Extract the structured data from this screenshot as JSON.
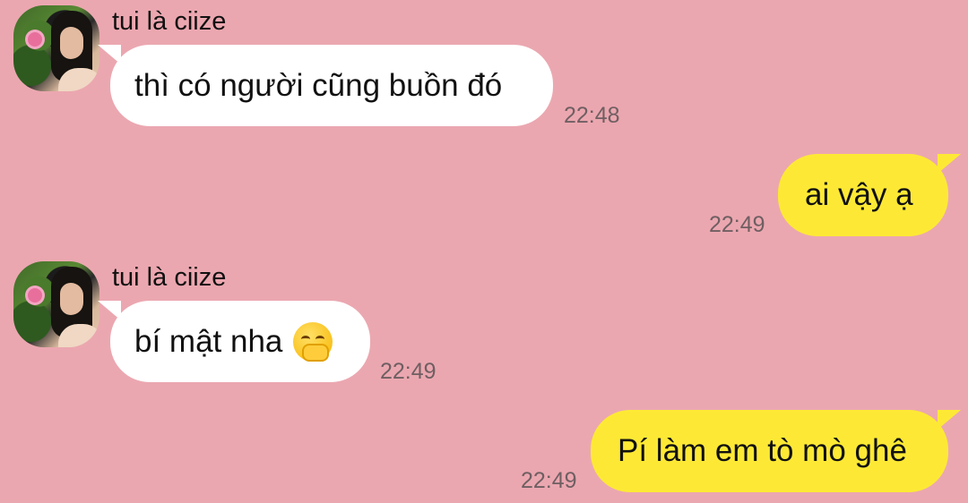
{
  "contact": {
    "name": "tui là ciize"
  },
  "messages": [
    {
      "direction": "incoming",
      "sender": "tui là ciize",
      "text": "thì có người cũng buồn đó",
      "time": "22:48"
    },
    {
      "direction": "outgoing",
      "text": "ai vậy ạ",
      "time": "22:49"
    },
    {
      "direction": "incoming",
      "sender": "tui là ciize",
      "text": "bí mật nha",
      "emoji": "face-with-hand-over-mouth-icon",
      "time": "22:49"
    },
    {
      "direction": "outgoing",
      "text": "Pí làm em tò mò ghê",
      "time": "22:49"
    }
  ],
  "colors": {
    "background": "#eba7b0",
    "incoming_bubble": "#ffffff",
    "outgoing_bubble": "#fde935",
    "timestamp": "#6f5f62"
  }
}
